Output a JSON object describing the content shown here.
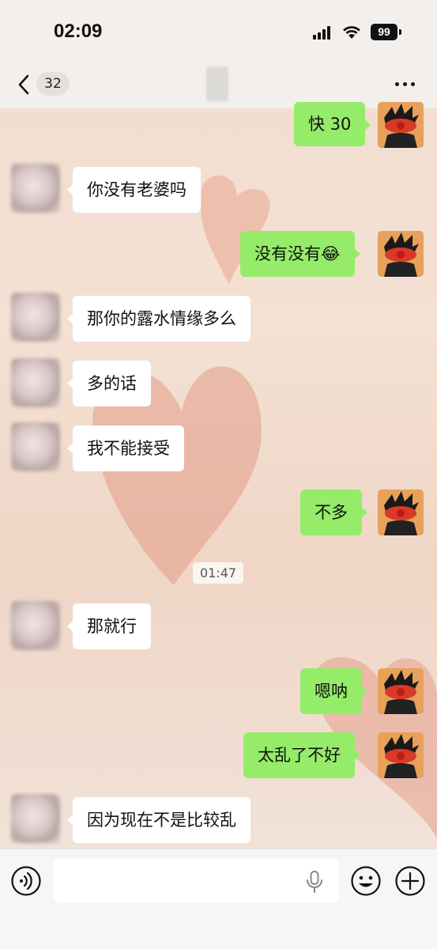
{
  "status_bar": {
    "time": "02:09",
    "battery": "99"
  },
  "header": {
    "unread_count": "32"
  },
  "timestamp": "01:47",
  "messages": [
    {
      "from": "me",
      "text": "快 30"
    },
    {
      "from": "other",
      "text": "你没有老婆吗"
    },
    {
      "from": "me",
      "text": "没有没有😂"
    },
    {
      "from": "other",
      "text": "那你的露水情缘多么"
    },
    {
      "from": "other",
      "text": "多的话"
    },
    {
      "from": "other",
      "text": "我不能接受"
    },
    {
      "from": "me",
      "text": "不多"
    },
    {
      "from": "other",
      "text": "那就行"
    },
    {
      "from": "me",
      "text": "嗯呐"
    },
    {
      "from": "me",
      "text": "太乱了不好"
    },
    {
      "from": "other",
      "text": "因为现在不是比较乱"
    }
  ],
  "colors": {
    "outgoing_bubble": "#95ec69",
    "incoming_bubble": "#ffffff",
    "bar_bg": "#f3efec"
  }
}
